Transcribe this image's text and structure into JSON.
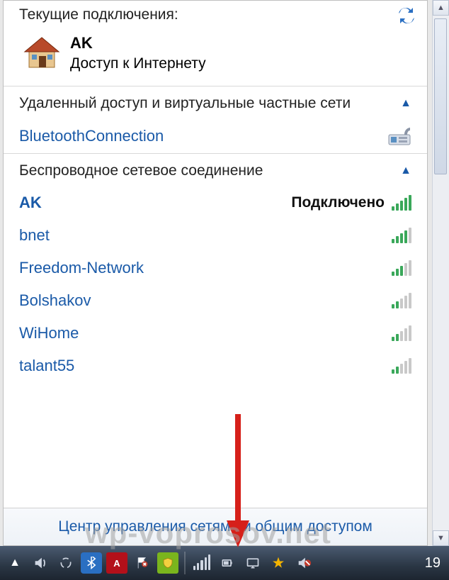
{
  "header": {
    "title": "Текущие подключения:",
    "refresh_tooltip": "Обновить"
  },
  "current": {
    "name": "AK",
    "status": "Доступ к Интернету"
  },
  "groups": {
    "vpn": {
      "title": "Удаленный доступ и виртуальные частные сети",
      "collapsed": false,
      "items": [
        {
          "name": "BluetoothConnection",
          "icon": "fax"
        }
      ]
    },
    "wifi": {
      "title": "Беспроводное сетевое соединение",
      "collapsed": false,
      "items": [
        {
          "name": "AK",
          "status": "Подключено",
          "signal": 5
        },
        {
          "name": "bnet",
          "signal": 4
        },
        {
          "name": "Freedom-Network",
          "signal": 3
        },
        {
          "name": "Bolshakov",
          "signal": 2
        },
        {
          "name": "WiHome",
          "signal": 2
        },
        {
          "name": "talant55",
          "signal": 2
        }
      ]
    }
  },
  "footer": {
    "link": "Центр управления сетями и общим доступом"
  },
  "taskbar": {
    "clock": "19"
  },
  "watermark": "wp-voprosov.net"
}
